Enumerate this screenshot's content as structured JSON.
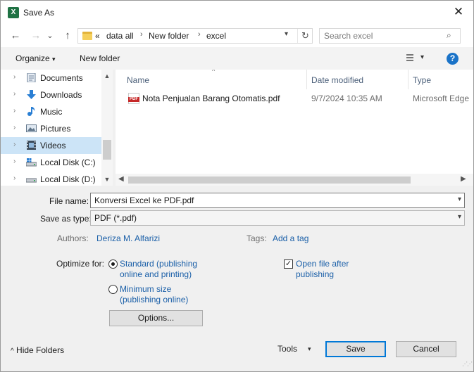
{
  "window": {
    "title": "Save As",
    "app_icon": "excel-icon",
    "close_glyph": "✕"
  },
  "nav": {
    "back_glyph": "←",
    "forward_glyph": "→",
    "recent_glyph": "⌄",
    "up_glyph": "↑",
    "breadcrumb": {
      "overflow": "«",
      "items": [
        "data all",
        "New folder",
        "excel"
      ],
      "separator": "›"
    },
    "refresh_glyph": "↻",
    "search_placeholder": "Search excel",
    "search_glyph": "⌕"
  },
  "toolbar": {
    "organize": "Organize",
    "new_folder": "New folder",
    "dropdown_glyph": "▾",
    "help_glyph": "?"
  },
  "sidebar": {
    "items": [
      {
        "label": "Documents",
        "icon": "documents-icon"
      },
      {
        "label": "Downloads",
        "icon": "downloads-icon"
      },
      {
        "label": "Music",
        "icon": "music-icon"
      },
      {
        "label": "Pictures",
        "icon": "pictures-icon"
      },
      {
        "label": "Videos",
        "icon": "videos-icon",
        "selected": true
      },
      {
        "label": "Local Disk (C:)",
        "icon": "drive-icon"
      },
      {
        "label": "Local Disk (D:)",
        "icon": "drive-icon"
      }
    ],
    "chevron_glyph": "›"
  },
  "files": {
    "columns": {
      "name": "Name",
      "date": "Date modified",
      "type": "Type"
    },
    "rows": [
      {
        "name": "Nota Penjualan Barang Otomatis.pdf",
        "date": "9/7/2024 10:35 AM",
        "type": "Microsoft Edge"
      }
    ],
    "sort_glyph": "^"
  },
  "form": {
    "file_name_label": "File name:",
    "file_name_value": "Konversi Excel ke PDF.pdf",
    "save_type_label": "Save as type:",
    "save_type_value": "PDF (*.pdf)",
    "authors_label": "Authors:",
    "authors_value": "Deriza M. Alfarizi",
    "tags_label": "Tags:",
    "tags_value": "Add a tag",
    "optimize_label": "Optimize for:",
    "opt_standard_line1": "Standard (publishing",
    "opt_standard_line2": "online and printing)",
    "opt_min_line1": "Minimum size",
    "opt_min_line2": "(publishing online)",
    "open_after_line1": "Open file after",
    "open_after_line2": "publishing",
    "options_button": "Options..."
  },
  "footer": {
    "hide_folders": "Hide Folders",
    "hide_glyph": "^",
    "tools": "Tools",
    "save": "Save",
    "cancel": "Cancel"
  },
  "colors": {
    "accent": "#0078d7",
    "link": "#1a5fa8",
    "selection": "#cce4f7",
    "dialog_bg": "#f0f0f0"
  }
}
